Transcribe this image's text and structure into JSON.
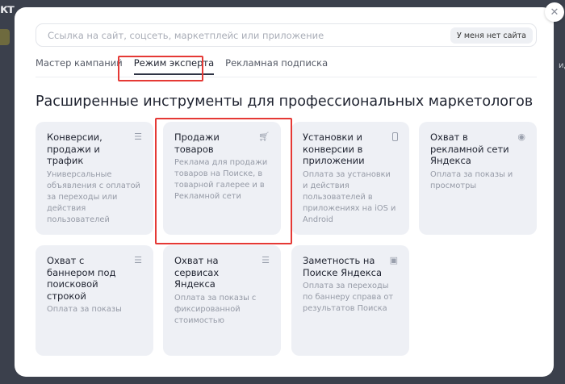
{
  "background": {
    "left_text": "кт",
    "right_text": "ид"
  },
  "search": {
    "placeholder": "Ссылка на сайт, соцсеть, маркетплейс или приложение",
    "no_site_button": "У меня нет сайта"
  },
  "tabs": [
    {
      "label": "Мастер кампаний"
    },
    {
      "label": "Режим эксперта",
      "active": true
    },
    {
      "label": "Рекламная подписка"
    }
  ],
  "heading": "Расширенные инструменты для профессиональных маркетологов",
  "cards": [
    {
      "title": "Конверсии, продажи и трафик",
      "desc": "Универсальные объявления с оплатой за переходы или действия пользователей",
      "icon": "list-icon"
    },
    {
      "title": "Продажи товаров",
      "desc": "Реклама для продажи товаров на Поиске, в товарной галерее и в Рекламной сети",
      "icon": "cart-icon"
    },
    {
      "title": "Установки и конверсии в приложении",
      "desc": "Оплата за установки и действия пользователей в приложениях на iOS и Android",
      "icon": "phone-icon"
    },
    {
      "title": "Охват в рекламной сети Яндекса",
      "desc": "Оплата за показы и просмотры",
      "icon": "eye-icon"
    },
    {
      "title": "Охват с баннером под поисковой строкой",
      "desc": "Оплата за показы",
      "icon": "banner-icon"
    },
    {
      "title": "Охват на сервисах Яндекса",
      "desc": "Оплата за показы с фиксированной стоимостью",
      "icon": "banner-icon"
    },
    {
      "title": "Заметность на Поиске Яндекса",
      "desc": "Оплата за переходы по баннеру справа от результатов Поиска",
      "icon": "side-banner-icon"
    }
  ],
  "colors": {
    "highlight": "#e53935",
    "card_bg": "#eef0f5",
    "overlay": "#3b404c"
  }
}
